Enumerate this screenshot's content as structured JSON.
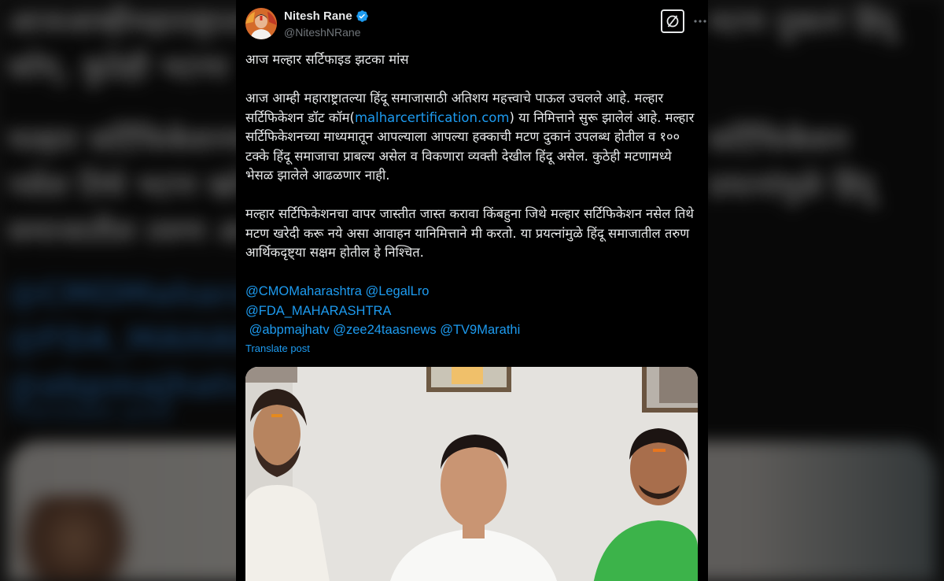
{
  "author": {
    "display_name": "Nitesh Rane",
    "handle": "@NiteshNRane",
    "verified": true,
    "verified_color": "#1d9bf0"
  },
  "header": {
    "grok_icon": "grok-slash-icon",
    "more_icon": "more-horizontal-icon"
  },
  "post": {
    "title_line": "आज मल्हार सर्टिफाइड झटका मांस",
    "para1_part1": "आज आम्ही महाराष्ट्रातल्या हिंदू समाजासाठी अतिशय महत्त्वाचे पाऊल उचलले आहे. मल्हार सर्टिफिकेशन डॉट कॉम(",
    "para1_link": "malharcertification.com",
    "para1_part2": ") या निमित्ताने सुरू झालेलं आहे. मल्हार सर्टिफिकेशनच्या माध्यमातून आपल्याला आपल्या हक्काची मटण दुकानं उपलब्ध होतील व १०० टक्के हिंदू समाजाचा प्राबल्य असेल व विकणारा व्यक्ती देखील हिंदू असेल. कुठेही मटणामध्ये भेसळ झालेले आढळणार नाही.",
    "para2": "मल्हार सर्टिफिकेशनचा वापर जास्तीत जास्त करावा किंबहुना जिथे मल्हार सर्टिफिकेशन नसेल तिथे मटण खरेदी करू नये असा आवाहन यानिमित्ताने मी करतो. या प्रयत्नांमुळे हिंदू समाजातील तरुण आर्थिकदृष्ट्या सक्षम होतील हे निश्चित.",
    "mentions": [
      "@CMOMaharashtra @LegalLro",
      "@FDA_MAHARASHTRA",
      " @abpmajhatv @zee24taasnews @TV9Marathi"
    ],
    "translate_label": "Translate post"
  },
  "colors": {
    "background": "#000000",
    "text": "#e7e9ea",
    "link": "#1d9bf0",
    "secondary": "#71767b"
  }
}
